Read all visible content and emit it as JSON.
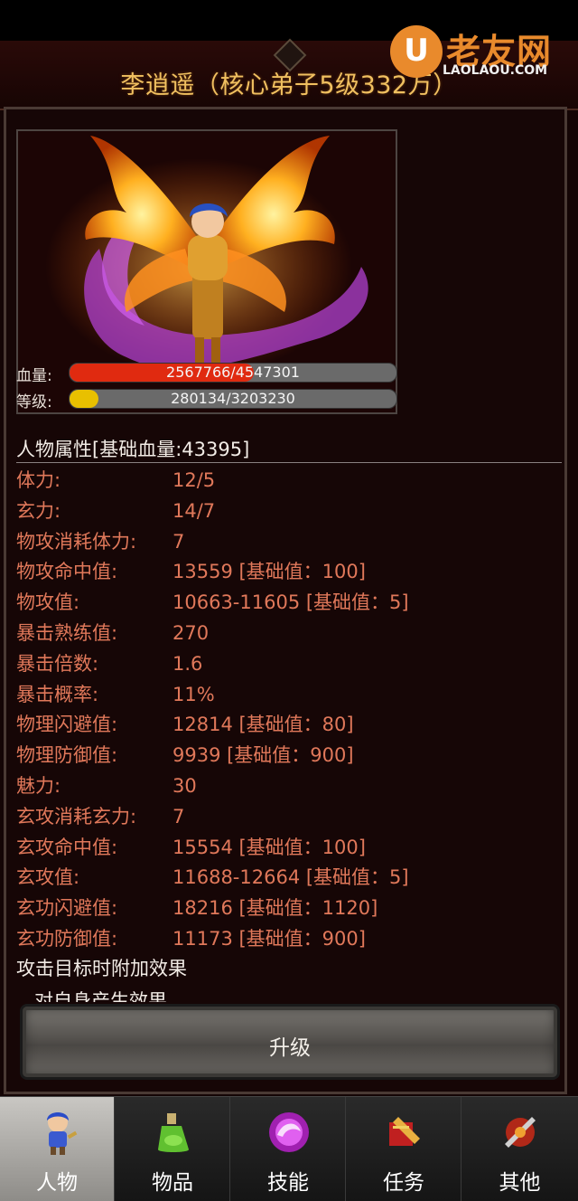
{
  "header": {
    "title": "李逍遥（核心弟子5级332万）"
  },
  "watermark": {
    "logo_letter": "U",
    "name": "老友网",
    "url": "LAOLAOU.COM"
  },
  "stats": {
    "hp": {
      "label": "血量:",
      "current": 2567766,
      "max": 4547301,
      "text": "2567766/4547301",
      "color": "#e02a10"
    },
    "level": {
      "label": "等级:",
      "current": 280134,
      "max": 3203230,
      "text": "280134/3203230",
      "color": "#e8c000"
    }
  },
  "attributes": {
    "title": "人物属性[基础血量:43395]",
    "rows": [
      {
        "label": "体力:",
        "value": "12/5"
      },
      {
        "label": "玄力:",
        "value": "14/7"
      },
      {
        "label": "物攻消耗体力:",
        "value": "7"
      },
      {
        "label": "物攻命中值:",
        "value": "13559 [基础值：100]"
      },
      {
        "label": "物攻值:",
        "value": "10663-11605 [基础值：5]"
      },
      {
        "label": "暴击熟练值:",
        "value": "270"
      },
      {
        "label": "暴击倍数:",
        "value": "1.6"
      },
      {
        "label": "暴击概率:",
        "value": "11%"
      },
      {
        "label": "物理闪避值:",
        "value": "12814 [基础值：80]"
      },
      {
        "label": "物理防御值:",
        "value": "9939 [基础值：900]"
      },
      {
        "label": "魅力:",
        "value": "30"
      },
      {
        "label": "玄攻消耗玄力:",
        "value": "7"
      },
      {
        "label": "玄攻命中值:",
        "value": "15554 [基础值：100]"
      },
      {
        "label": "玄攻值:",
        "value": "11688-12664 [基础值：5]"
      },
      {
        "label": "玄功闪避值:",
        "value": "18216 [基础值：1120]"
      },
      {
        "label": "玄功防御值:",
        "value": "11173 [基础值：900]"
      }
    ]
  },
  "effects": {
    "title": "攻击目标时附加效果",
    "subtitle": "对自身产生效果"
  },
  "upgrade_button": {
    "label": "升级"
  },
  "tabs": [
    {
      "label": "人物",
      "icon": "character-icon",
      "active": true
    },
    {
      "label": "物品",
      "icon": "potion-icon",
      "active": false
    },
    {
      "label": "技能",
      "icon": "skill-orb-icon",
      "active": false
    },
    {
      "label": "任务",
      "icon": "quest-icon",
      "active": false
    },
    {
      "label": "其他",
      "icon": "other-icon",
      "active": false
    }
  ],
  "colors": {
    "attribute_text": "#e0785a",
    "title_gold": "#f0c060",
    "watermark_orange": "#e98a2c"
  }
}
